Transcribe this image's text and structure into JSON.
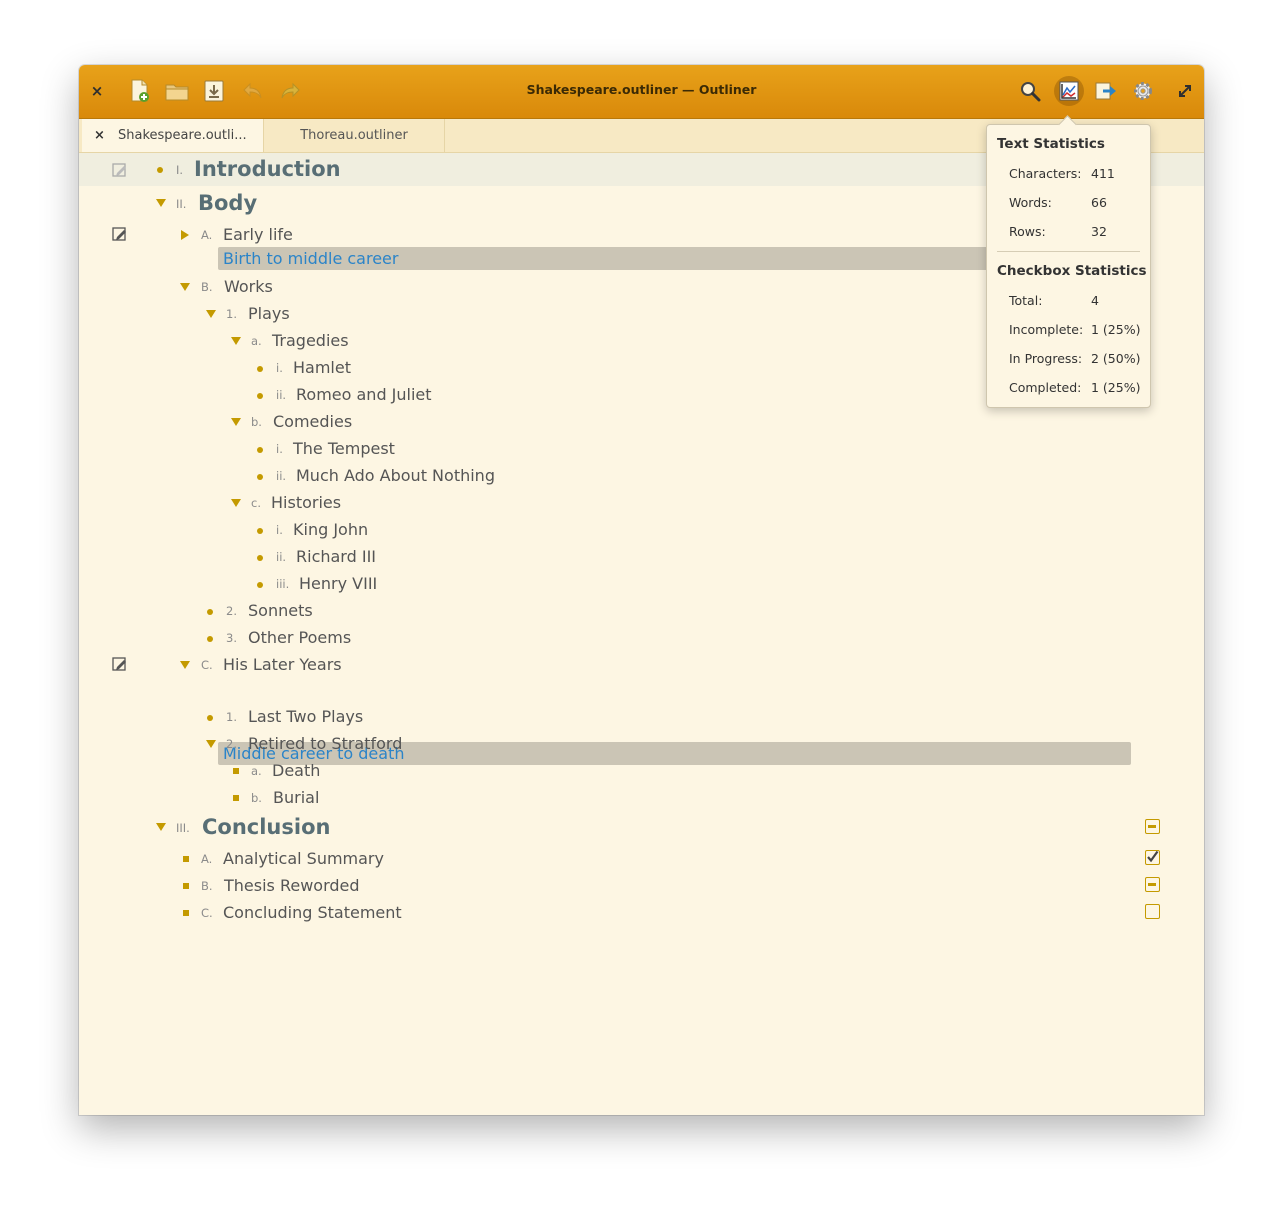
{
  "window": {
    "title": "Shakespeare.outliner — Outliner"
  },
  "toolbar": {
    "close_label": "×"
  },
  "tabs": [
    {
      "label": "Shakespeare.outli...",
      "close": "×"
    },
    {
      "label": "Thoreau.outliner"
    }
  ],
  "outline": {
    "intro": {
      "num": "I.",
      "text": "Introduction"
    },
    "body": {
      "num": "II.",
      "text": "Body"
    },
    "early_life": {
      "num": "A.",
      "text": "Early life",
      "note": "Birth to middle career"
    },
    "works": {
      "num": "B.",
      "text": "Works"
    },
    "plays": {
      "num": "1.",
      "text": "Plays"
    },
    "tragedies": {
      "num": "a.",
      "text": "Tragedies"
    },
    "hamlet": {
      "num": "i.",
      "text": "Hamlet"
    },
    "romeo": {
      "num": "ii.",
      "text": "Romeo and Juliet"
    },
    "comedies": {
      "num": "b.",
      "text": "Comedies"
    },
    "tempest": {
      "num": "i.",
      "text": "The Tempest"
    },
    "much_ado": {
      "num": "ii.",
      "text": "Much Ado About Nothing"
    },
    "histories": {
      "num": "c.",
      "text": "Histories"
    },
    "king_john": {
      "num": "i.",
      "text": "King John"
    },
    "richard": {
      "num": "ii.",
      "text": "Richard III"
    },
    "henry": {
      "num": "iii.",
      "text": "Henry VIII"
    },
    "sonnets": {
      "num": "2.",
      "text": "Sonnets"
    },
    "other_poems": {
      "num": "3.",
      "text": "Other Poems"
    },
    "later_years": {
      "num": "C.",
      "text": "His Later Years",
      "note": "Middle career to death"
    },
    "last_two": {
      "num": "1.",
      "text": "Last Two Plays"
    },
    "retired": {
      "num": "2.",
      "text": "Retired to Stratford"
    },
    "death": {
      "num": "a.",
      "text": "Death"
    },
    "burial": {
      "num": "b.",
      "text": "Burial"
    },
    "conclusion": {
      "num": "III.",
      "text": "Conclusion"
    },
    "analytical": {
      "num": "A.",
      "text": "Analytical Summary"
    },
    "thesis": {
      "num": "B.",
      "text": "Thesis Reworded"
    },
    "concluding": {
      "num": "C.",
      "text": "Concluding Statement"
    }
  },
  "checkbox_states": {
    "conclusion": "in-progress",
    "analytical": "completed",
    "thesis": "in-progress",
    "concluding": "incomplete"
  },
  "stats": {
    "text_title": "Text Statistics",
    "characters_label": "Characters:",
    "characters": "411",
    "words_label": "Words:",
    "words": "66",
    "rows_label": "Rows:",
    "rows": "32",
    "checkbox_title": "Checkbox Statistics",
    "total_label": "Total:",
    "total": "4",
    "incomplete_label": "Incomplete:",
    "incomplete": "1  (25%)",
    "in_progress_label": "In Progress:",
    "in_progress": "2  (50%)",
    "completed_label": "Completed:",
    "completed": "1  (25%)"
  },
  "colors": {
    "accent": "#d9890a",
    "bullet": "#c49a00",
    "note_text": "#2b84c8"
  }
}
